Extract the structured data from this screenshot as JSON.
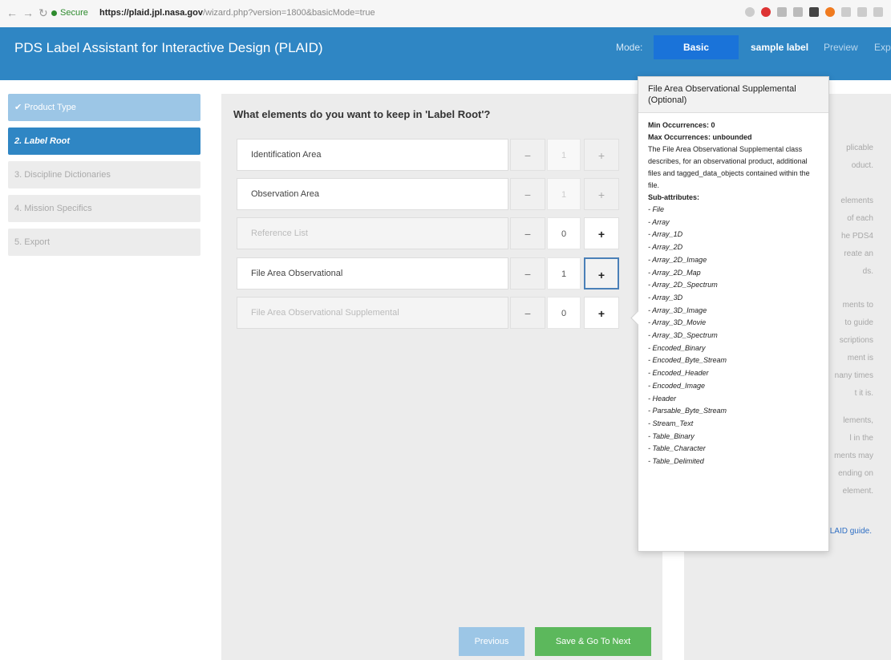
{
  "browser": {
    "secure_label": "Secure",
    "url_host": "https://plaid.jpl.nasa.gov",
    "url_path": "/wizard.php?version=1800&basicMode=true"
  },
  "header": {
    "title": "PDS Label Assistant for Interactive Design (PLAID)",
    "mode_label": "Mode:",
    "mode_value": "Basic",
    "label_name": "sample label",
    "preview": "Preview",
    "export": "Export"
  },
  "sidebar": {
    "steps": [
      {
        "label": "✔ Product Type"
      },
      {
        "label": "2. Label Root"
      },
      {
        "label": "3. Discipline Dictionaries"
      },
      {
        "label": "4. Mission Specifics"
      },
      {
        "label": "5. Export"
      }
    ]
  },
  "main": {
    "question": "What elements do you want to keep in 'Label Root'?",
    "rows": [
      {
        "name": "Identification Area",
        "count": "1",
        "minus": "−",
        "plus": "+"
      },
      {
        "name": "Observation Area",
        "count": "1",
        "minus": "−",
        "plus": "+"
      },
      {
        "name": "Reference List",
        "count": "0",
        "minus": "−",
        "plus": "+"
      },
      {
        "name": "File Area Observational",
        "count": "1",
        "minus": "−",
        "plus": "+"
      },
      {
        "name": "File Area Observational Supplemental",
        "count": "0",
        "minus": "−",
        "plus": "+"
      }
    ],
    "previous_label": "Previous",
    "next_label": "Save & Go To Next"
  },
  "help": {
    "lines": [
      "plicable",
      "oduct.",
      "elements",
      "of each",
      "he PDS4",
      "reate an",
      "ds.",
      "ments to",
      "to guide",
      "scriptions",
      "ment is",
      "nany times",
      "t it is.",
      "lements,",
      "l in the",
      "ments may",
      "ending on",
      "element.",
      "LAID guide."
    ]
  },
  "tooltip": {
    "title": "File Area Observational Supplemental (Optional)",
    "min": "Min Occurrences: 0",
    "max": "Max Occurrences: unbounded",
    "description": "The File Area Observational Supplemental class describes, for an observational product, additional files and tagged_data_objects contained within the file.",
    "sub_heading": "Sub-attributes:",
    "sub_attributes": [
      "- File",
      "- Array",
      "- Array_1D",
      "- Array_2D",
      "- Array_2D_Image",
      "- Array_2D_Map",
      "- Array_2D_Spectrum",
      "- Array_3D",
      "- Array_3D_Image",
      "- Array_3D_Movie",
      "- Array_3D_Spectrum",
      "- Encoded_Binary",
      "- Encoded_Byte_Stream",
      "- Encoded_Header",
      "- Encoded_Image",
      "- Header",
      "- Parsable_Byte_Stream",
      "- Stream_Text",
      "- Table_Binary",
      "- Table_Character",
      "- Table_Delimited"
    ]
  }
}
